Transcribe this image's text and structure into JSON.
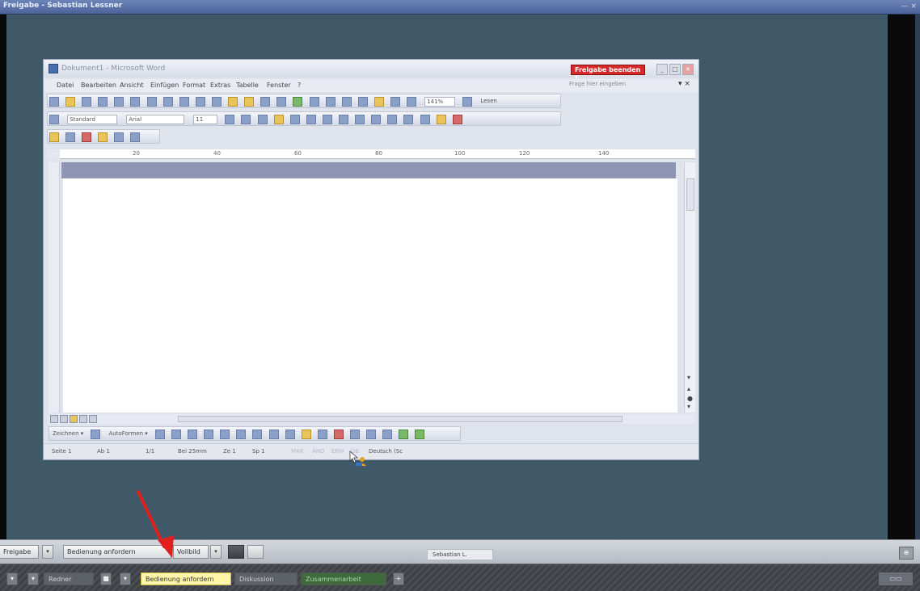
{
  "outer_window": {
    "title": "Freigabe - Sebastian Lessner",
    "buttons": "— ×"
  },
  "word": {
    "title": "Dokument1 - Microsoft Word",
    "freigabe_button": "Freigabe beenden ▾",
    "menus": [
      "Datei",
      "Bearbeiten",
      "Ansicht",
      "Einfügen",
      "Format",
      "Extras",
      "Tabelle",
      "Fenster",
      "?"
    ],
    "help_placeholder": "Frage hier eingeben",
    "menu_close": "▾ ×",
    "standard_toolbar": {
      "zoom": "141%",
      "read": "Lesen"
    },
    "format_toolbar": {
      "style": "Standard",
      "font": "Arial",
      "size": "11"
    },
    "ruler_labels": [
      "20",
      "40",
      "60",
      "80",
      "100",
      "120",
      "140"
    ],
    "draw_toolbar": {
      "draw": "Zeichnen ▾",
      "autoshapes": "AutoFormen ▾"
    },
    "status": {
      "page": "Seite 1",
      "section": "Ab 1",
      "pages": "1/1",
      "position": "Bei 25mm",
      "line": "Ze 1",
      "column": "Sp 1",
      "rec": "MAK",
      "trk": "ÄND",
      "ext": "ERW",
      "ovr": "ÜB",
      "language": "Deutsch (Sc"
    }
  },
  "control_bar": {
    "freigabe": "Freigabe",
    "request_control": "Bedienung anfordern",
    "fullscreen": "Vollbild",
    "presenter": "Sebastian L."
  },
  "taskbar": {
    "people": "Redner",
    "request_control": "Bedienung anfordern",
    "discussion": "Diskussion",
    "collaborative": "Zusammenarbeit",
    "add": "+"
  },
  "colors": {
    "remote_bg": "#3f5969",
    "freigabe_red": "#d42a2a",
    "active_tab_yellow": "#fff6a8",
    "annotation_arrow": "#e0201e"
  }
}
